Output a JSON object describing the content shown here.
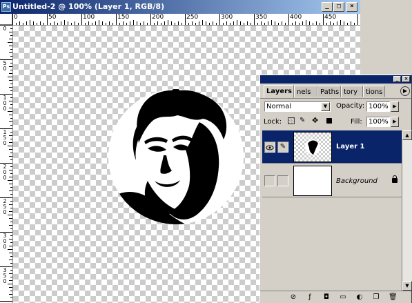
{
  "document": {
    "title": "Untitled-2 @ 100% (Layer 1, RGB/8)",
    "app_icon": "Ps",
    "window_buttons": {
      "minimize": "_",
      "maximize": "□",
      "close": "×"
    }
  },
  "rulers": {
    "horizontal_labels": [
      "0",
      "50",
      "100",
      "150",
      "200",
      "250",
      "300",
      "350",
      "400",
      "450"
    ],
    "vertical_labels": [
      "0",
      "50",
      "100",
      "150",
      "200",
      "250",
      "300",
      "350"
    ]
  },
  "layers_palette": {
    "tabs": [
      "Layers",
      "nels",
      "Paths",
      "tory",
      "tions"
    ],
    "blend_mode": "Normal",
    "opacity_label": "Opacity:",
    "opacity_value": "100%",
    "lock_label": "Lock:",
    "fill_label": "Fill:",
    "fill_value": "100%",
    "layers": [
      {
        "name": "Layer 1",
        "visible": true,
        "selected": true
      },
      {
        "name": "Background",
        "visible": false,
        "selected": false,
        "locked": true
      }
    ],
    "footer_icons": [
      "link-icon",
      "layer-style-icon",
      "mask-icon",
      "new-set-icon",
      "adjustment-layer-icon",
      "new-layer-icon",
      "trash-icon"
    ],
    "colors": {
      "selected_row": "#0a246a",
      "title_bar": "#0a246a"
    }
  }
}
